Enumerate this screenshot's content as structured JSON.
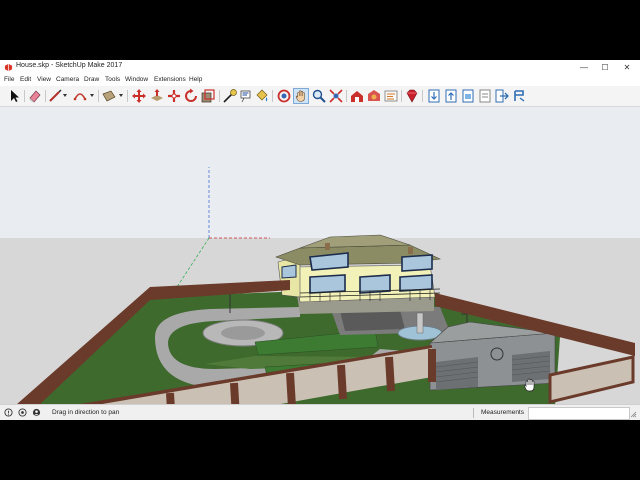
{
  "window": {
    "title": "House.skp - SketchUp Make 2017",
    "controls": {
      "minimize": "—",
      "maximize": "☐",
      "close": "✕"
    }
  },
  "menus": [
    "File",
    "Edit",
    "View",
    "Camera",
    "Draw",
    "Tools",
    "Window",
    "Extensions",
    "Help"
  ],
  "toolbar": {
    "tools": [
      "select-tool-icon",
      "eraser-tool-icon",
      "line-tool-icon",
      "arc-tool-icon",
      "rectangle-tool-icon",
      "move-tool-icon",
      "push-pull-tool-icon",
      "rotate-tool-icon",
      "follow-me-tool-icon",
      "scale-tool-icon",
      "offset-tool-icon",
      "tape-measure-tool-icon",
      "text-tool-icon",
      "paint-bucket-tool-icon",
      "orbit-tool-icon",
      "pan-tool-icon",
      "zoom-tool-icon",
      "zoom-extents-tool-icon",
      "3d-warehouse-icon",
      "extension-warehouse-icon",
      "layout-icon",
      "ruby-console-icon",
      "get-models-icon",
      "share-model-icon",
      "upload-component-icon",
      "share-component-icon",
      "export-icon"
    ],
    "active_tool": "pan-tool-icon"
  },
  "status": {
    "hint": "Drag in direction to pan",
    "measurements_label": "Measurements",
    "measurements_value": ""
  },
  "colors": {
    "sky": "#e9ecf0",
    "ground": "#d7d7d7",
    "lawn": "#3f6a2d",
    "pavement": "#a9a9a9",
    "brick": "#6a3a2a",
    "stone": "#cbc0b4",
    "wall_yellow": "#f2f1b7",
    "roof": "#8b8b64",
    "garage": "#8d9193"
  }
}
